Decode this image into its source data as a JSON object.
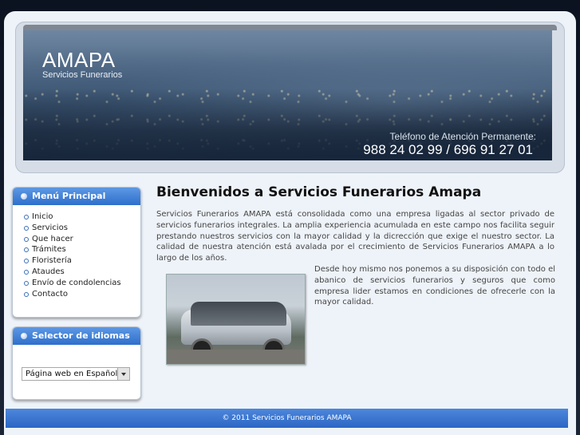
{
  "header": {
    "logo_title": "AMAPA",
    "logo_subtitle": "Servicios Funerarios",
    "phone_label": "Teléfono de Atención Permanente:",
    "phone_number": "988 24 02 99 / 696 91 27 01"
  },
  "sidebar": {
    "menu_title": "Menú Principal",
    "menu_items": [
      {
        "label": "Inicio"
      },
      {
        "label": "Servicios"
      },
      {
        "label": "Que hacer"
      },
      {
        "label": "Trámites"
      },
      {
        "label": "Floristería"
      },
      {
        "label": "Ataudes"
      },
      {
        "label": "Envío de condolencias"
      },
      {
        "label": "Contacto"
      }
    ],
    "language_title": "Selector de idiomas",
    "language_selected": "Página web en Español"
  },
  "main": {
    "title": "Bienvenidos a Servicios Funerarios Amapa",
    "paragraph1": "Servicios Funerarios AMAPA está consolidada como una empresa ligadas al sector privado de servicios funerarios integrales. La amplia experiencia acumulada en este campo nos facilita seguir prestando nuestros servicios con la mayor calidad y la dicrección que exige el nuestro sector. La calidad de nuestra atención está avalada por el crecimiento de Servicios Funerarios AMAPA a lo largo de los años.",
    "paragraph2": "Desde hoy mismo nos ponemos a su disposición con todo el abanico de servicios funerarios y seguros que como empresa lider estamos en condiciones de ofrecerle con la mayor calidad."
  },
  "footer": {
    "copyright": "© 2011 Servicios Funerarios AMAPA"
  },
  "colors": {
    "accent": "#2e6fcc",
    "footer": "#3b76d0",
    "page_bg": "#eef3f9"
  }
}
